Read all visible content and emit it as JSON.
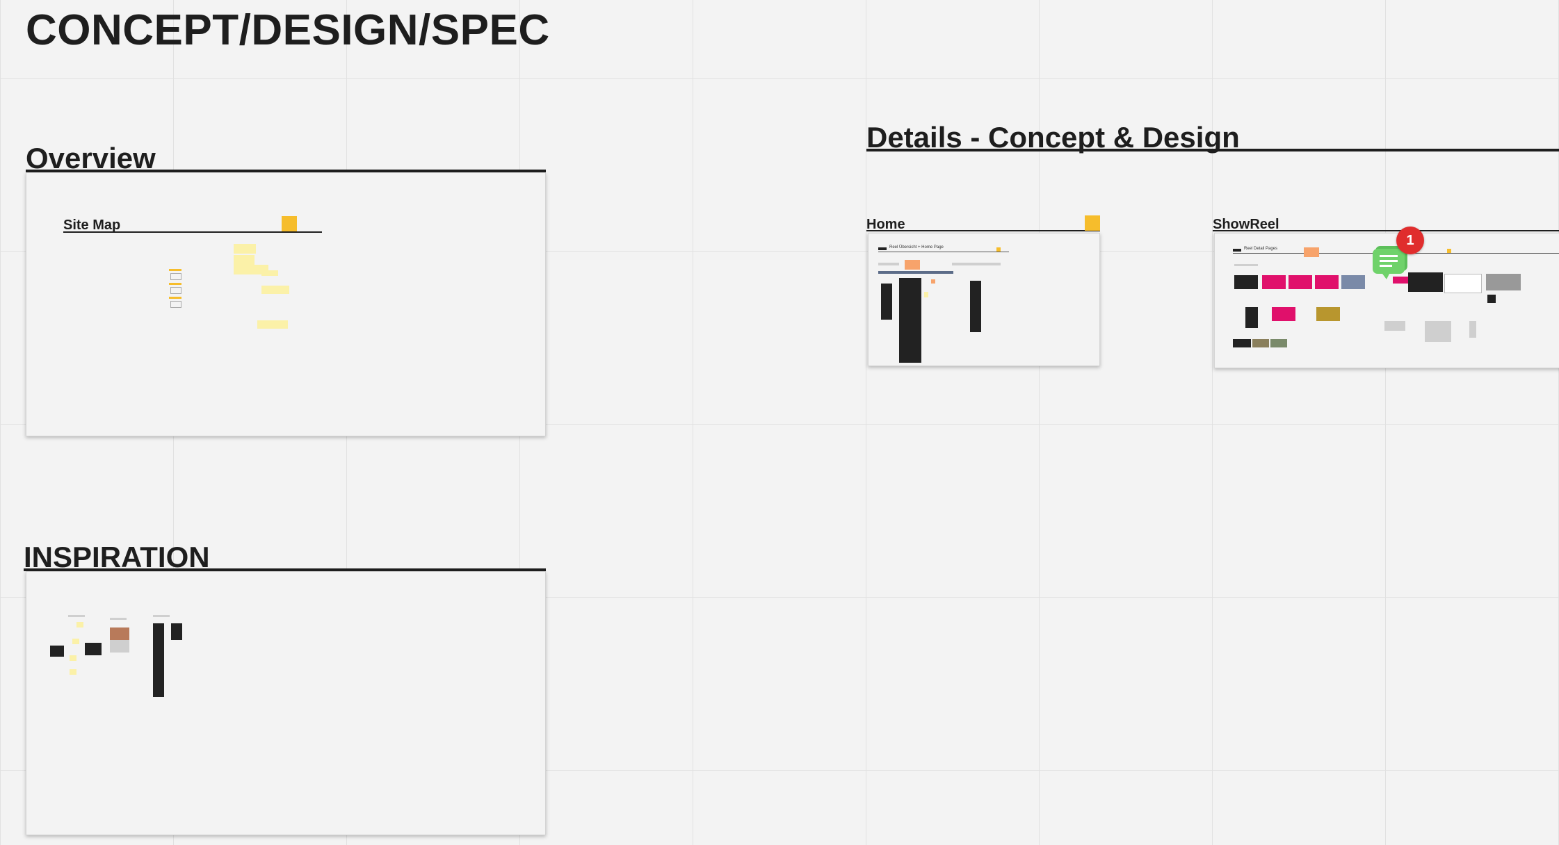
{
  "board": {
    "title": "CONCEPT/DESIGN/SPEC"
  },
  "sections": {
    "overview": "Overview",
    "details": "Details - Concept & Design",
    "inspiration": "INSPIRATION"
  },
  "frames": {
    "site_map": "Site Map",
    "home": "Home",
    "showreel": "ShowReel",
    "home_thumb_label": "Reel Übersicht + Home Page",
    "showreel_thumb_label": "Reel Detail Pages"
  },
  "comment": {
    "count": "1"
  },
  "colors": {
    "background": "#f3f3f3",
    "title": "#1e1e1e",
    "sticky_yellow": "#fbf1a8",
    "sticky_orange": "#f7a36b",
    "marker_yellow": "#f6bd2c",
    "comment_green": "#5cbf5a",
    "badge_red": "#e02d2d",
    "accent_pink": "#e0106b"
  },
  "icons": {
    "comment": "comment-bubble-icon"
  }
}
